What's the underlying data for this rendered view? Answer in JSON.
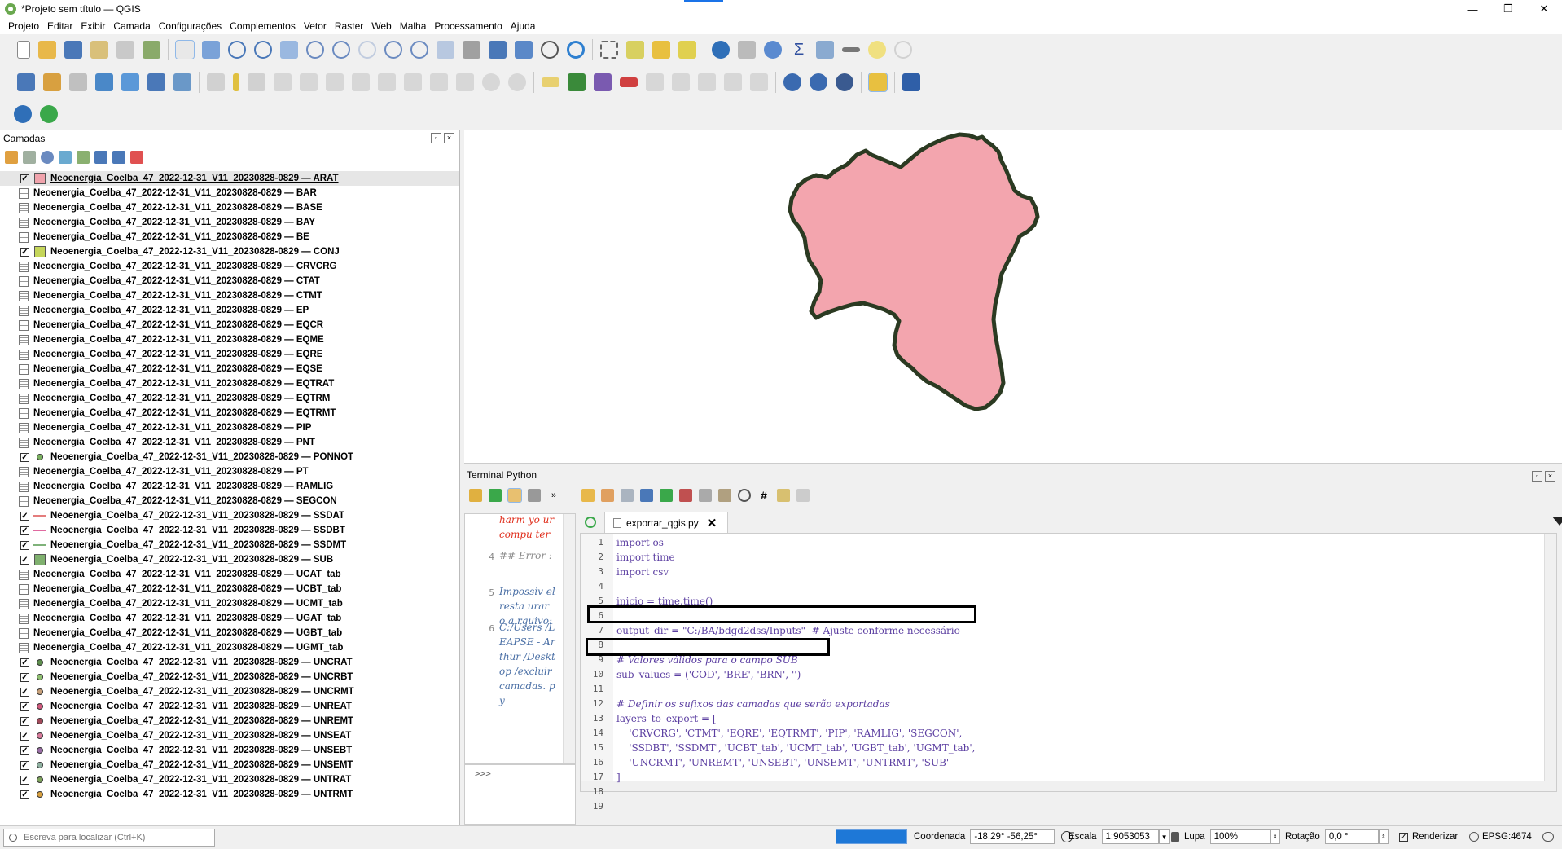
{
  "app": {
    "title": "*Projeto sem título — QGIS",
    "window_buttons": [
      "—",
      "❐",
      "✕"
    ]
  },
  "menu": [
    "Projeto",
    "Editar",
    "Exibir",
    "Camada",
    "Configurações",
    "Complementos",
    "Vetor",
    "Raster",
    "Web",
    "Malha",
    "Processamento",
    "Ajuda"
  ],
  "layers_panel": {
    "title": "Camadas",
    "layers": [
      {
        "name": "Neoenergia_Coelba_47_2022-12-31_V11_20230828-0829 — ARAT",
        "checked": true,
        "symbol": "poly",
        "color": "#f0a3ac",
        "selected": true
      },
      {
        "name": "Neoenergia_Coelba_47_2022-12-31_V11_20230828-0829 — BAR",
        "checked": false,
        "symbol": "table"
      },
      {
        "name": "Neoenergia_Coelba_47_2022-12-31_V11_20230828-0829 — BASE",
        "checked": false,
        "symbol": "table"
      },
      {
        "name": "Neoenergia_Coelba_47_2022-12-31_V11_20230828-0829 — BAY",
        "checked": false,
        "symbol": "table"
      },
      {
        "name": "Neoenergia_Coelba_47_2022-12-31_V11_20230828-0829 — BE",
        "checked": false,
        "symbol": "table"
      },
      {
        "name": "Neoenergia_Coelba_47_2022-12-31_V11_20230828-0829 — CONJ",
        "checked": true,
        "symbol": "poly",
        "color": "#c5d65a"
      },
      {
        "name": "Neoenergia_Coelba_47_2022-12-31_V11_20230828-0829 — CRVCRG",
        "checked": false,
        "symbol": "table"
      },
      {
        "name": "Neoenergia_Coelba_47_2022-12-31_V11_20230828-0829 — CTAT",
        "checked": false,
        "symbol": "table"
      },
      {
        "name": "Neoenergia_Coelba_47_2022-12-31_V11_20230828-0829 — CTMT",
        "checked": false,
        "symbol": "table"
      },
      {
        "name": "Neoenergia_Coelba_47_2022-12-31_V11_20230828-0829 — EP",
        "checked": false,
        "symbol": "table"
      },
      {
        "name": "Neoenergia_Coelba_47_2022-12-31_V11_20230828-0829 — EQCR",
        "checked": false,
        "symbol": "table"
      },
      {
        "name": "Neoenergia_Coelba_47_2022-12-31_V11_20230828-0829 — EQME",
        "checked": false,
        "symbol": "table"
      },
      {
        "name": "Neoenergia_Coelba_47_2022-12-31_V11_20230828-0829 — EQRE",
        "checked": false,
        "symbol": "table"
      },
      {
        "name": "Neoenergia_Coelba_47_2022-12-31_V11_20230828-0829 — EQSE",
        "checked": false,
        "symbol": "table"
      },
      {
        "name": "Neoenergia_Coelba_47_2022-12-31_V11_20230828-0829 — EQTRAT",
        "checked": false,
        "symbol": "table"
      },
      {
        "name": "Neoenergia_Coelba_47_2022-12-31_V11_20230828-0829 — EQTRM",
        "checked": false,
        "symbol": "table"
      },
      {
        "name": "Neoenergia_Coelba_47_2022-12-31_V11_20230828-0829 — EQTRMT",
        "checked": false,
        "symbol": "table"
      },
      {
        "name": "Neoenergia_Coelba_47_2022-12-31_V11_20230828-0829 — PIP",
        "checked": false,
        "symbol": "table"
      },
      {
        "name": "Neoenergia_Coelba_47_2022-12-31_V11_20230828-0829 — PNT",
        "checked": false,
        "symbol": "table"
      },
      {
        "name": "Neoenergia_Coelba_47_2022-12-31_V11_20230828-0829 — PONNOT",
        "checked": true,
        "symbol": "dot",
        "color": "#7bb061"
      },
      {
        "name": "Neoenergia_Coelba_47_2022-12-31_V11_20230828-0829 — PT",
        "checked": false,
        "symbol": "table"
      },
      {
        "name": "Neoenergia_Coelba_47_2022-12-31_V11_20230828-0829 — RAMLIG",
        "checked": false,
        "symbol": "table"
      },
      {
        "name": "Neoenergia_Coelba_47_2022-12-31_V11_20230828-0829 — SEGCON",
        "checked": false,
        "symbol": "table"
      },
      {
        "name": "Neoenergia_Coelba_47_2022-12-31_V11_20230828-0829 — SSDAT",
        "checked": true,
        "symbol": "line",
        "color": "#e47d7d"
      },
      {
        "name": "Neoenergia_Coelba_47_2022-12-31_V11_20230828-0829 — SSDBT",
        "checked": true,
        "symbol": "line",
        "color": "#e06aa0"
      },
      {
        "name": "Neoenergia_Coelba_47_2022-12-31_V11_20230828-0829 — SSDMT",
        "checked": true,
        "symbol": "line",
        "color": "#7fb27a"
      },
      {
        "name": "Neoenergia_Coelba_47_2022-12-31_V11_20230828-0829 — SUB",
        "checked": true,
        "symbol": "poly",
        "color": "#7fb06e"
      },
      {
        "name": "Neoenergia_Coelba_47_2022-12-31_V11_20230828-0829 — UCAT_tab",
        "checked": false,
        "symbol": "table"
      },
      {
        "name": "Neoenergia_Coelba_47_2022-12-31_V11_20230828-0829 — UCBT_tab",
        "checked": false,
        "symbol": "table"
      },
      {
        "name": "Neoenergia_Coelba_47_2022-12-31_V11_20230828-0829 — UCMT_tab",
        "checked": false,
        "symbol": "table"
      },
      {
        "name": "Neoenergia_Coelba_47_2022-12-31_V11_20230828-0829 — UGAT_tab",
        "checked": false,
        "symbol": "table"
      },
      {
        "name": "Neoenergia_Coelba_47_2022-12-31_V11_20230828-0829 — UGBT_tab",
        "checked": false,
        "symbol": "table"
      },
      {
        "name": "Neoenergia_Coelba_47_2022-12-31_V11_20230828-0829 — UGMT_tab",
        "checked": false,
        "symbol": "table"
      },
      {
        "name": "Neoenergia_Coelba_47_2022-12-31_V11_20230828-0829 — UNCRAT",
        "checked": true,
        "symbol": "dot",
        "color": "#5e8f4e"
      },
      {
        "name": "Neoenergia_Coelba_47_2022-12-31_V11_20230828-0829 — UNCRBT",
        "checked": true,
        "symbol": "dot",
        "color": "#8fbf72"
      },
      {
        "name": "Neoenergia_Coelba_47_2022-12-31_V11_20230828-0829 — UNCRMT",
        "checked": true,
        "symbol": "dot",
        "color": "#c7a07a"
      },
      {
        "name": "Neoenergia_Coelba_47_2022-12-31_V11_20230828-0829 — UNREAT",
        "checked": true,
        "symbol": "dot",
        "color": "#d05a7e"
      },
      {
        "name": "Neoenergia_Coelba_47_2022-12-31_V11_20230828-0829 — UNREMT",
        "checked": true,
        "symbol": "dot",
        "color": "#a04a5a"
      },
      {
        "name": "Neoenergia_Coelba_47_2022-12-31_V11_20230828-0829 — UNSEAT",
        "checked": true,
        "symbol": "dot",
        "color": "#d77b9b"
      },
      {
        "name": "Neoenergia_Coelba_47_2022-12-31_V11_20230828-0829 — UNSEBT",
        "checked": true,
        "symbol": "dot",
        "color": "#9a6ea6"
      },
      {
        "name": "Neoenergia_Coelba_47_2022-12-31_V11_20230828-0829 — UNSEMT",
        "checked": true,
        "symbol": "dot",
        "color": "#8fb0a0"
      },
      {
        "name": "Neoenergia_Coelba_47_2022-12-31_V11_20230828-0829 — UNTRAT",
        "checked": true,
        "symbol": "dot",
        "color": "#7fa35e"
      },
      {
        "name": "Neoenergia_Coelba_47_2022-12-31_V11_20230828-0829 — UNTRMT",
        "checked": true,
        "symbol": "dot",
        "color": "#d8a040"
      }
    ]
  },
  "map": {
    "fill_color": "#f3a5ae",
    "border_color": "#2b3a22"
  },
  "python_console": {
    "title": "Terminal Python",
    "output": [
      {
        "line": "",
        "text": "harm yo ur compu ter",
        "color": "#e0301e"
      },
      {
        "line": "4",
        "text": "## Error :",
        "color": "#888888"
      },
      {
        "line": "5",
        "text": "Impossiv el resta urar o a rquivo:",
        "color": "#4a6fa5"
      },
      {
        "line": "6",
        "text": "C:/Users /LEAPSE - Arthur /Desktop /excluir camadas. py",
        "color": "#4a6fa5"
      }
    ],
    "prompt": ">>>",
    "editor_tab": "exportar_qgis.py",
    "code_lines": [
      {
        "n": "1",
        "code": "import os"
      },
      {
        "n": "2",
        "code": "import time"
      },
      {
        "n": "3",
        "code": "import csv"
      },
      {
        "n": "4",
        "code": ""
      },
      {
        "n": "5",
        "code": "inicio = time.time()"
      },
      {
        "n": "6",
        "code": ""
      },
      {
        "n": "7",
        "code": "output_dir = \"C:/BA/bdgd2dss/Inputs\"  # Ajuste conforme necessário"
      },
      {
        "n": "8",
        "code": ""
      },
      {
        "n": "9",
        "code": "# Valores válidos para o campo SUB"
      },
      {
        "n": "10",
        "code": "sub_values = ('COD', 'BRE', 'BRN', '')"
      },
      {
        "n": "11",
        "code": ""
      },
      {
        "n": "12",
        "code": "# Definir os sufixos das camadas que serão exportadas"
      },
      {
        "n": "13",
        "code": "layers_to_export = ["
      },
      {
        "n": "14",
        "code": "    'CRVCRG', 'CTMT', 'EQRE', 'EQTRMT', 'PIP', 'RAMLIG', 'SEGCON',"
      },
      {
        "n": "15",
        "code": "    'SSDBT', 'SSDMT', 'UCBT_tab', 'UCMT_tab', 'UGBT_tab', 'UGMT_tab',"
      },
      {
        "n": "16",
        "code": "    'UNCRMT', 'UNREMT', 'UNSEBT', 'UNSEMT', 'UNTRMT', 'SUB'"
      },
      {
        "n": "17",
        "code": "]"
      },
      {
        "n": "18",
        "code": ""
      },
      {
        "n": "19",
        "code": ""
      }
    ]
  },
  "statusbar": {
    "search_placeholder": "Escreva para localizar (Ctrl+K)",
    "coord_label": "Coordenada",
    "coord_value": "-18,29° -56,25°",
    "scale_label": "Escala",
    "scale_value": "1:9053053",
    "magnifier_label": "Lupa",
    "magnifier_value": "100%",
    "rotation_label": "Rotação",
    "rotation_value": "0,0 °",
    "render_label": "Renderizar",
    "crs": "EPSG:4674",
    "progress_color": "#1e78d7"
  }
}
